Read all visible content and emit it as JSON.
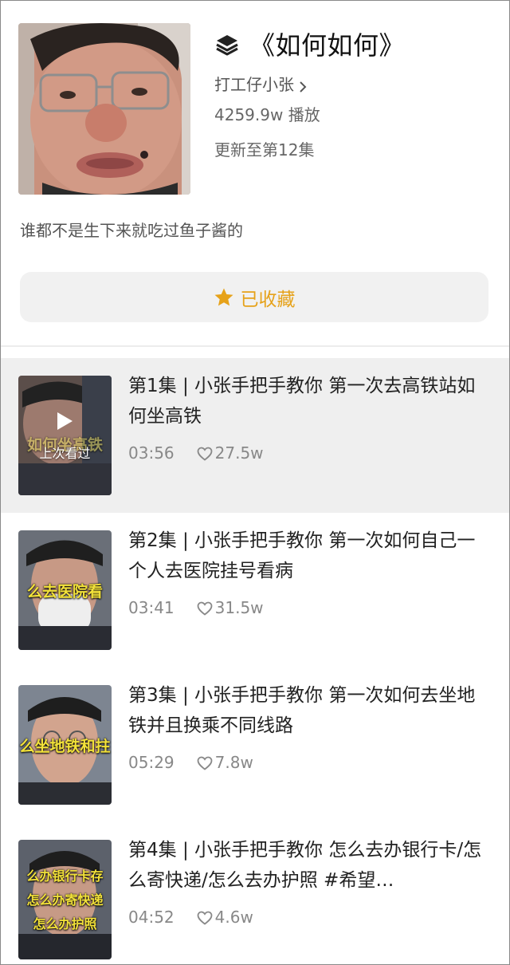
{
  "playlist": {
    "title": "《如何如何》",
    "author": "打工仔小张",
    "plays": "4259.9w 播放",
    "updated": "更新至第12集",
    "description": "谁都不是生下来就吃过鱼子酱的",
    "favorite_label": "已收藏"
  },
  "episodes": [
    {
      "title": "第1集 | 小张手把手教你 第一次去高铁站如何坐高铁",
      "duration": "03:56",
      "likes": "27.5w",
      "watched_label": "上次看过",
      "thumb_caption": "如何坐高铁"
    },
    {
      "title": "第2集 | 小张手把手教你 第一次如何自己一个人去医院挂号看病",
      "duration": "03:41",
      "likes": "31.5w",
      "thumb_caption": "么去医院看"
    },
    {
      "title": "第3集 | 小张手把手教你 第一次如何去坐地铁并且换乘不同线路",
      "duration": "05:29",
      "likes": "7.8w",
      "thumb_caption": "么坐地铁和拄"
    },
    {
      "title": "第4集 | 小张手把手教你 怎么去办银行卡/怎么寄快递/怎么去办护照 #希望…",
      "duration": "04:52",
      "likes": "4.6w",
      "thumb_caption_lines": [
        "么办银行卡存",
        "怎么办寄快递",
        "怎么办护照"
      ]
    }
  ],
  "colors": {
    "accent": "#e6a21a",
    "active_row_bg": "#efefef"
  },
  "icons": {
    "title": "layers-icon",
    "author": "chevron-right-icon",
    "favorite": "star-icon",
    "likes": "heart-icon",
    "play": "play-icon"
  }
}
